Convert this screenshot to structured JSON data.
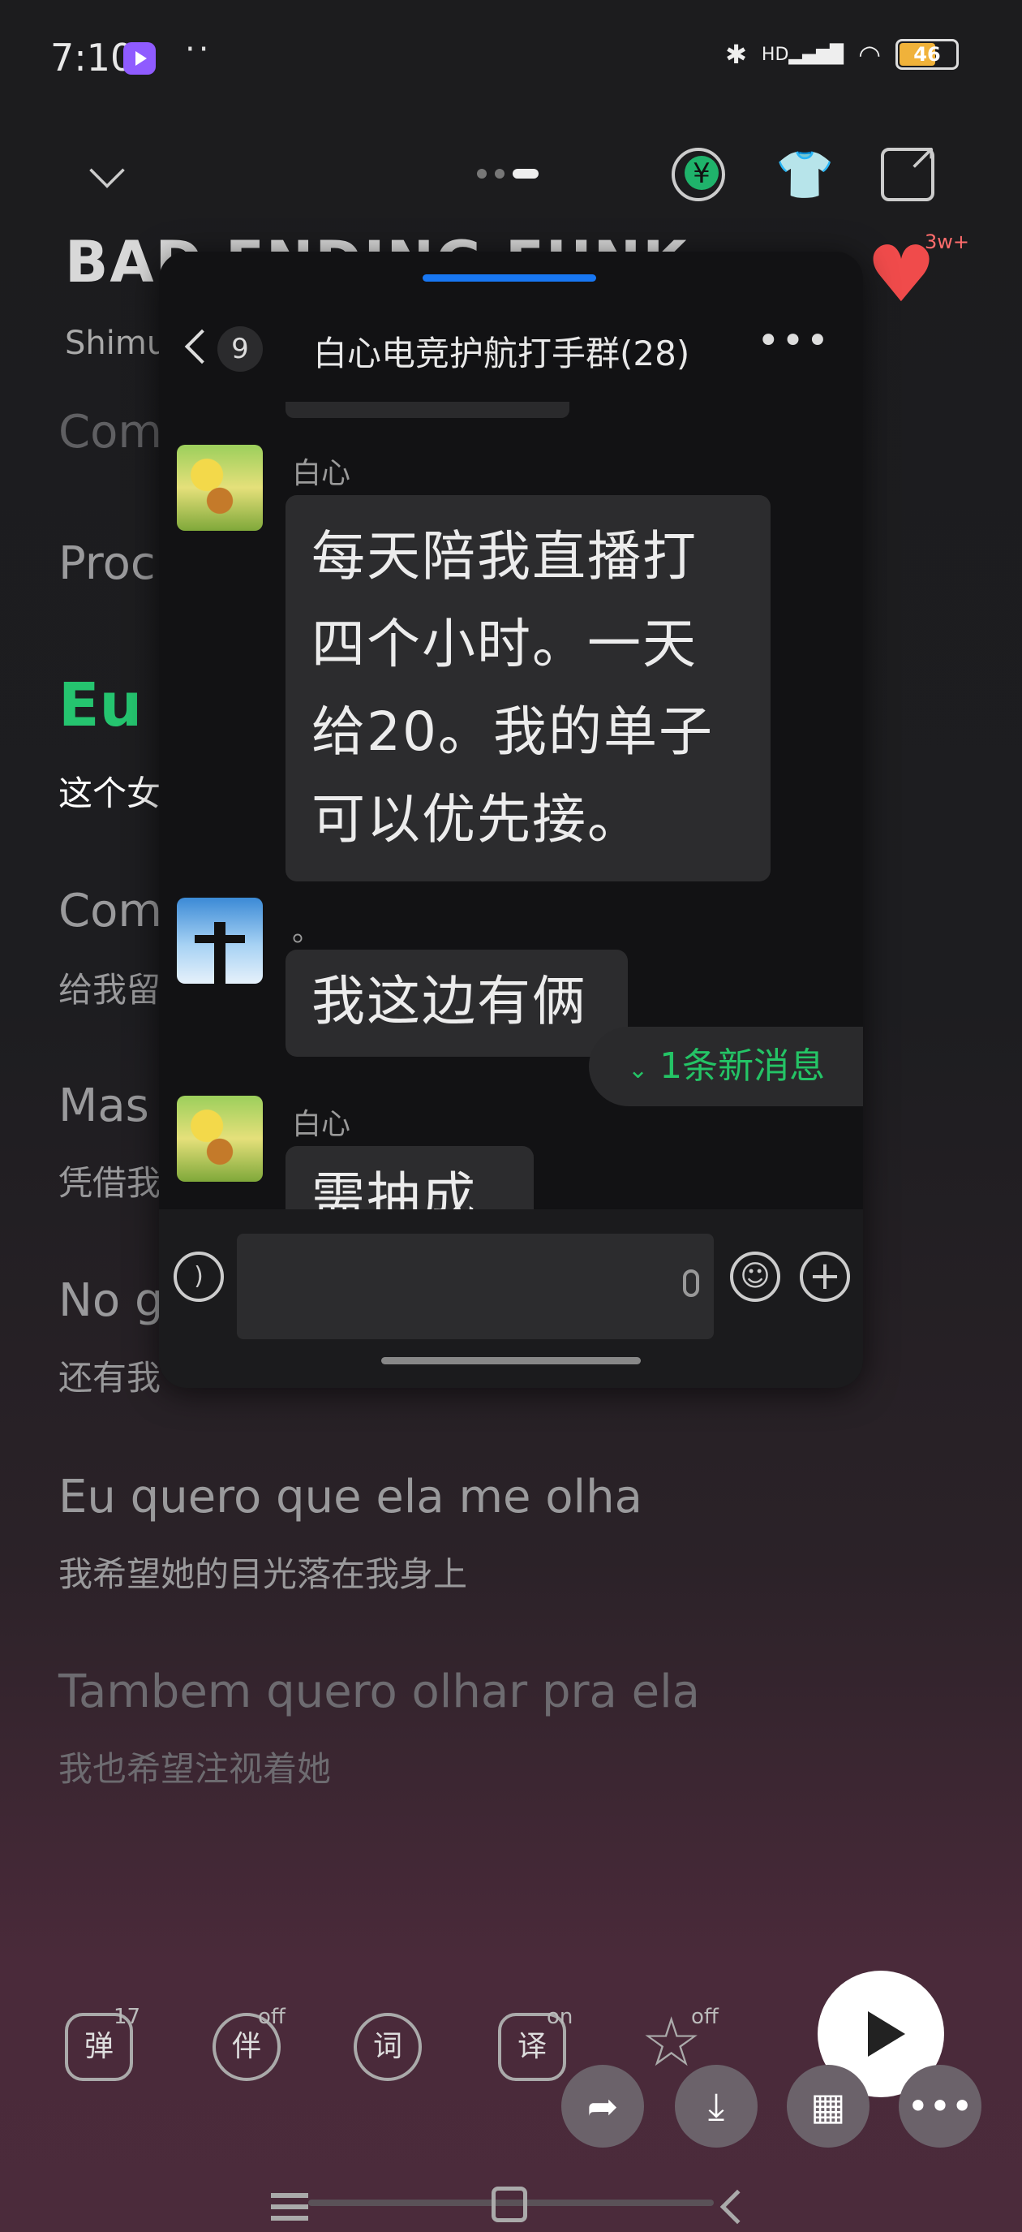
{
  "status_bar": {
    "time": "7:10",
    "dots": "··",
    "network": "HD",
    "battery": "46"
  },
  "top_bar": {
    "heart_count": "3w+"
  },
  "song": {
    "title": "BAD ENDING FUNK",
    "artist": "Shimu"
  },
  "lyrics": [
    {
      "en": "Com",
      "cn": ""
    },
    {
      "en": "Proc",
      "cn": ""
    },
    {
      "en": "Eu",
      "cn": "这个女"
    },
    {
      "en": "Com",
      "cn": "给我留"
    },
    {
      "en": "Mas",
      "cn": "凭借我"
    },
    {
      "en": "No g",
      "cn": "还有我"
    },
    {
      "en": "Eu quero que ela me olha",
      "cn": "我希望她的目光落在我身上"
    },
    {
      "en": "Tambem quero olhar pra ela",
      "cn": "我也希望注视着她"
    }
  ],
  "chat": {
    "unread_count": "9",
    "group_name": "白心电竞护航打手群(28)",
    "messages": [
      {
        "sender": "白心",
        "text_lines": [
          "每天陪我直播打",
          "四个小时。一天",
          "给20。我的单子",
          "可以优先接。"
        ]
      },
      {
        "sender": "。",
        "text_lines": [
          "我这边有俩"
        ]
      },
      {
        "sender": "白心",
        "text_lines": [
          "需抽成"
        ]
      }
    ],
    "new_message_banner": "1条新消息"
  },
  "controls": {
    "danmaku": {
      "label": "弹",
      "badge": "17"
    },
    "accompany": {
      "label": "伴",
      "badge": "off"
    },
    "lyrics_word": {
      "label": "词"
    },
    "translate": {
      "label": "译",
      "badge": "on"
    },
    "favorite": {
      "badge": "off"
    }
  }
}
